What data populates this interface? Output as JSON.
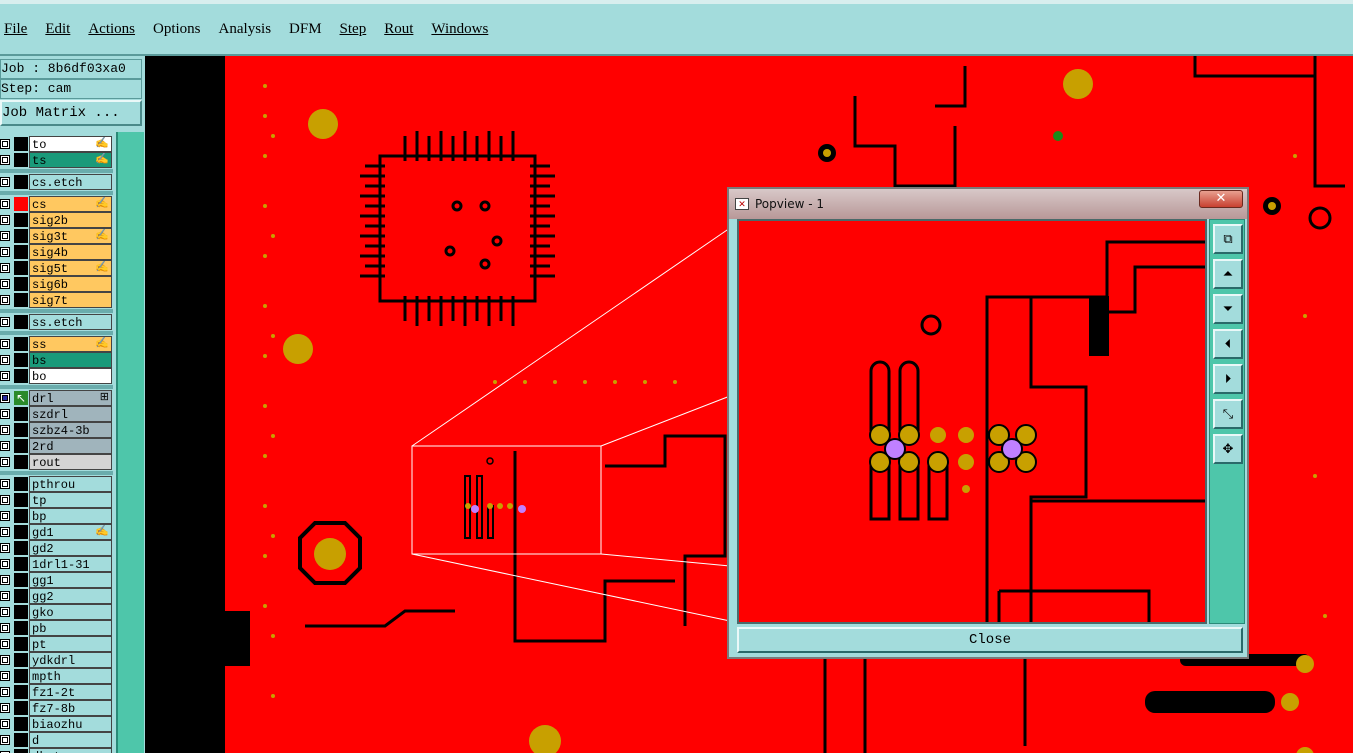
{
  "menu": {
    "items": [
      "File",
      "Edit",
      "Actions",
      "Options",
      "Analysis",
      "DFM",
      "Step",
      "Rout",
      "Windows"
    ]
  },
  "job_info": {
    "job_line": "Job : 8b6df03xa0",
    "step_line": "Step: cam",
    "matrix_button": "Job Matrix ..."
  },
  "layers": [
    {
      "name": "to",
      "color": "#ffffff",
      "swatch": "#000000",
      "mark": "✍"
    },
    {
      "name": "ts",
      "color": "#1a9a7a",
      "swatch": "#000000",
      "mark": "✍"
    },
    {
      "sep": true
    },
    {
      "name": "cs.etch",
      "color": "#a3dcdc",
      "swatch": "#000000",
      "mark": ""
    },
    {
      "sep": true
    },
    {
      "name": "cs",
      "color": "#ffc860",
      "swatch": "#ff0000",
      "mark": "✍"
    },
    {
      "name": "sig2b",
      "color": "#ffc860",
      "swatch": "#000000",
      "mark": ""
    },
    {
      "name": "sig3t",
      "color": "#ffc860",
      "swatch": "#000000",
      "mark": "✍"
    },
    {
      "name": "sig4b",
      "color": "#ffc860",
      "swatch": "#000000",
      "mark": ""
    },
    {
      "name": "sig5t",
      "color": "#ffc860",
      "swatch": "#000000",
      "mark": "✍"
    },
    {
      "name": "sig6b",
      "color": "#ffc860",
      "swatch": "#000000",
      "mark": ""
    },
    {
      "name": "sig7t",
      "color": "#ffc860",
      "swatch": "#000000",
      "mark": ""
    },
    {
      "sep": true
    },
    {
      "name": "ss.etch",
      "color": "#a3dcdc",
      "swatch": "#000000",
      "mark": ""
    },
    {
      "sep": true
    },
    {
      "name": "ss",
      "color": "#ffc860",
      "swatch": "#000000",
      "mark": "✍"
    },
    {
      "name": "bs",
      "color": "#1a9a7a",
      "swatch": "#000000",
      "mark": ""
    },
    {
      "name": "bo",
      "color": "#ffffff",
      "swatch": "#000000",
      "mark": ""
    },
    {
      "sep": true
    },
    {
      "name": "drl",
      "color": "#a0b4bc",
      "swatch": "#2a8a2a",
      "mark": "⊞",
      "active": true
    },
    {
      "name": "szdrl",
      "color": "#a0b4bc",
      "swatch": "#000000",
      "mark": ""
    },
    {
      "name": "szbz4-3b",
      "color": "#a0b4bc",
      "swatch": "#000000",
      "mark": ""
    },
    {
      "name": "2rd",
      "color": "#a0b4bc",
      "swatch": "#000000",
      "mark": ""
    },
    {
      "name": "rout",
      "color": "#d4d4d4",
      "swatch": "#000000",
      "mark": ""
    },
    {
      "sep": true
    },
    {
      "name": "pthrou",
      "color": "#a3dcdc",
      "swatch": "#000000",
      "mark": ""
    },
    {
      "name": "tp",
      "color": "#a3dcdc",
      "swatch": "#000000",
      "mark": ""
    },
    {
      "name": "bp",
      "color": "#a3dcdc",
      "swatch": "#000000",
      "mark": ""
    },
    {
      "name": "gd1",
      "color": "#a3dcdc",
      "swatch": "#000000",
      "mark": "✍"
    },
    {
      "name": "gd2",
      "color": "#a3dcdc",
      "swatch": "#000000",
      "mark": ""
    },
    {
      "name": "1drl1-31",
      "color": "#a3dcdc",
      "swatch": "#000000",
      "mark": ""
    },
    {
      "name": "gg1",
      "color": "#a3dcdc",
      "swatch": "#000000",
      "mark": ""
    },
    {
      "name": "gg2",
      "color": "#a3dcdc",
      "swatch": "#000000",
      "mark": ""
    },
    {
      "name": "gko",
      "color": "#a3dcdc",
      "swatch": "#000000",
      "mark": ""
    },
    {
      "name": "pb",
      "color": "#a3dcdc",
      "swatch": "#000000",
      "mark": ""
    },
    {
      "name": "pt",
      "color": "#a3dcdc",
      "swatch": "#000000",
      "mark": ""
    },
    {
      "name": "ydkdrl",
      "color": "#a3dcdc",
      "swatch": "#000000",
      "mark": ""
    },
    {
      "name": "mpth",
      "color": "#a3dcdc",
      "swatch": "#000000",
      "mark": ""
    },
    {
      "name": "fz1-2t",
      "color": "#a3dcdc",
      "swatch": "#000000",
      "mark": ""
    },
    {
      "name": "fz7-8b",
      "color": "#a3dcdc",
      "swatch": "#000000",
      "mark": ""
    },
    {
      "name": "biaozhu",
      "color": "#a3dcdc",
      "swatch": "#000000",
      "mark": ""
    },
    {
      "name": "d",
      "color": "#a3dcdc",
      "swatch": "#000000",
      "mark": ""
    },
    {
      "name": "dkst",
      "color": "#a3dcdc",
      "swatch": "#000000",
      "mark": ""
    }
  ],
  "popview": {
    "title": "Popview - 1",
    "close_x": "✕",
    "close_button": "Close",
    "tools": [
      "zoom-window-icon",
      "pan-up-icon",
      "pan-down-icon",
      "pan-left-icon",
      "pan-right-icon",
      "zoom-out-icon",
      "zoom-in-icon"
    ]
  },
  "colors": {
    "copper": "#ff0000",
    "pad": "#c8a000",
    "via_drill": "#c080ff",
    "panel": "#a3dcdc",
    "panel_accent": "#4ec6aa"
  }
}
